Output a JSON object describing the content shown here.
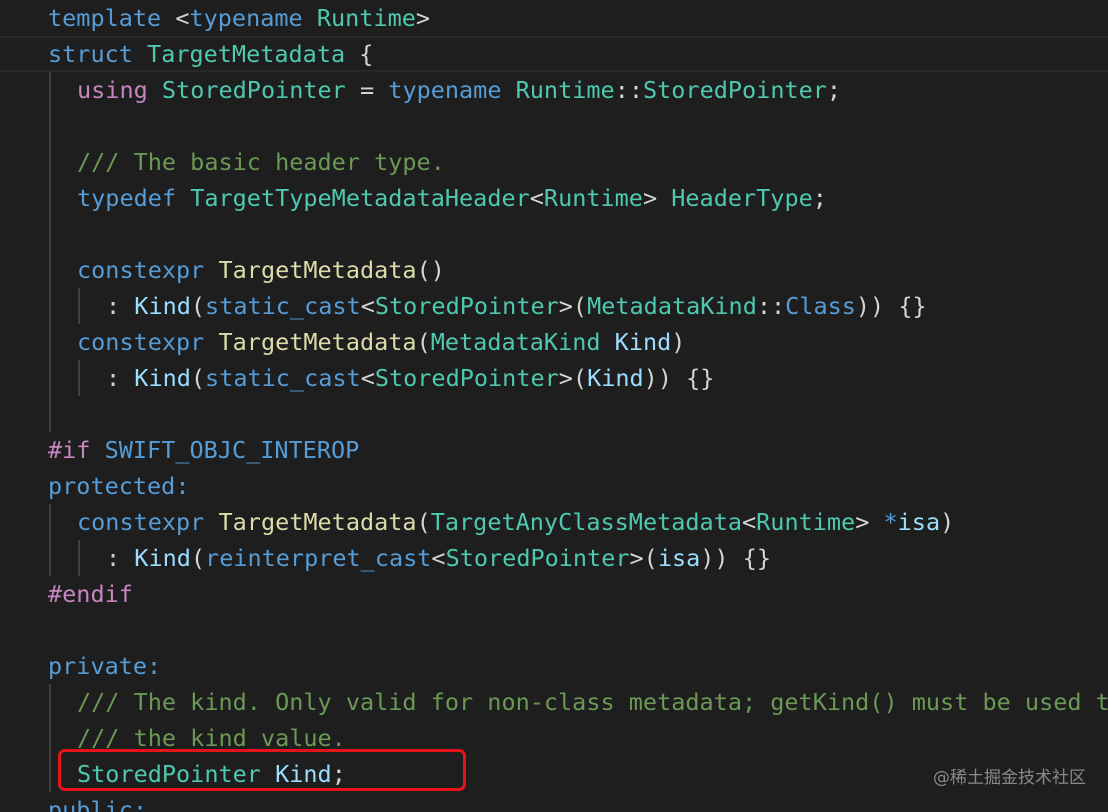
{
  "code_lines": [
    {
      "indent": 0,
      "tokens": [
        {
          "t": "template",
          "c": "kw"
        },
        {
          "t": " <",
          "c": "pn"
        },
        {
          "t": "typename",
          "c": "kw"
        },
        {
          "t": " ",
          "c": "pn"
        },
        {
          "t": "Runtime",
          "c": "ty"
        },
        {
          "t": ">",
          "c": "pn"
        }
      ]
    },
    {
      "indent": 0,
      "tokens": [
        {
          "t": "struct",
          "c": "kw"
        },
        {
          "t": " ",
          "c": "pn"
        },
        {
          "t": "TargetMetadata",
          "c": "ty"
        },
        {
          "t": " {",
          "c": "pn"
        }
      ]
    },
    {
      "indent": 1,
      "tokens": [
        {
          "t": "using",
          "c": "kw2"
        },
        {
          "t": " ",
          "c": "pn"
        },
        {
          "t": "StoredPointer",
          "c": "ty"
        },
        {
          "t": " = ",
          "c": "pn"
        },
        {
          "t": "typename",
          "c": "kw"
        },
        {
          "t": " ",
          "c": "pn"
        },
        {
          "t": "Runtime",
          "c": "ty"
        },
        {
          "t": "::",
          "c": "pn"
        },
        {
          "t": "StoredPointer",
          "c": "ty"
        },
        {
          "t": ";",
          "c": "pn"
        }
      ]
    },
    {
      "indent": 1,
      "tokens": []
    },
    {
      "indent": 1,
      "tokens": [
        {
          "t": "/// The basic header type.",
          "c": "cm"
        }
      ]
    },
    {
      "indent": 1,
      "tokens": [
        {
          "t": "typedef",
          "c": "kw"
        },
        {
          "t": " ",
          "c": "pn"
        },
        {
          "t": "TargetTypeMetadataHeader",
          "c": "ty"
        },
        {
          "t": "<",
          "c": "pn"
        },
        {
          "t": "Runtime",
          "c": "ty"
        },
        {
          "t": "> ",
          "c": "pn"
        },
        {
          "t": "HeaderType",
          "c": "ty"
        },
        {
          "t": ";",
          "c": "pn"
        }
      ]
    },
    {
      "indent": 1,
      "tokens": []
    },
    {
      "indent": 1,
      "tokens": [
        {
          "t": "constexpr",
          "c": "kw"
        },
        {
          "t": " ",
          "c": "pn"
        },
        {
          "t": "TargetMetadata",
          "c": "fn"
        },
        {
          "t": "()",
          "c": "pn"
        }
      ]
    },
    {
      "indent": 2,
      "tokens": [
        {
          "t": ": ",
          "c": "pn"
        },
        {
          "t": "Kind",
          "c": "vr"
        },
        {
          "t": "(",
          "c": "pn"
        },
        {
          "t": "static_cast",
          "c": "kw"
        },
        {
          "t": "<",
          "c": "pn"
        },
        {
          "t": "StoredPointer",
          "c": "ty"
        },
        {
          "t": ">(",
          "c": "pn"
        },
        {
          "t": "MetadataKind",
          "c": "ty"
        },
        {
          "t": "::",
          "c": "pn"
        },
        {
          "t": "Class",
          "c": "mc"
        },
        {
          "t": ")) {}",
          "c": "pn"
        }
      ]
    },
    {
      "indent": 1,
      "tokens": [
        {
          "t": "constexpr",
          "c": "kw"
        },
        {
          "t": " ",
          "c": "pn"
        },
        {
          "t": "TargetMetadata",
          "c": "fn"
        },
        {
          "t": "(",
          "c": "pn"
        },
        {
          "t": "MetadataKind",
          "c": "ty"
        },
        {
          "t": " ",
          "c": "pn"
        },
        {
          "t": "Kind",
          "c": "vr"
        },
        {
          "t": ")",
          "c": "pn"
        }
      ]
    },
    {
      "indent": 2,
      "tokens": [
        {
          "t": ": ",
          "c": "pn"
        },
        {
          "t": "Kind",
          "c": "vr"
        },
        {
          "t": "(",
          "c": "pn"
        },
        {
          "t": "static_cast",
          "c": "kw"
        },
        {
          "t": "<",
          "c": "pn"
        },
        {
          "t": "StoredPointer",
          "c": "ty"
        },
        {
          "t": ">(",
          "c": "pn"
        },
        {
          "t": "Kind",
          "c": "vr"
        },
        {
          "t": ")) {}",
          "c": "pn"
        }
      ]
    },
    {
      "indent": 1,
      "tokens": []
    },
    {
      "indent": 0,
      "tokens": [
        {
          "t": "#if",
          "c": "kw2"
        },
        {
          "t": " ",
          "c": "pn"
        },
        {
          "t": "SWIFT_OBJC_INTEROP",
          "c": "pp"
        }
      ]
    },
    {
      "indent": 0,
      "tokens": [
        {
          "t": "protected:",
          "c": "kw"
        }
      ]
    },
    {
      "indent": 1,
      "tokens": [
        {
          "t": "constexpr",
          "c": "kw"
        },
        {
          "t": " ",
          "c": "pn"
        },
        {
          "t": "TargetMetadata",
          "c": "fn"
        },
        {
          "t": "(",
          "c": "pn"
        },
        {
          "t": "TargetAnyClassMetadata",
          "c": "ty"
        },
        {
          "t": "<",
          "c": "pn"
        },
        {
          "t": "Runtime",
          "c": "ty"
        },
        {
          "t": "> ",
          "c": "pn"
        },
        {
          "t": "*",
          "c": "kw"
        },
        {
          "t": "isa",
          "c": "vr"
        },
        {
          "t": ")",
          "c": "pn"
        }
      ]
    },
    {
      "indent": 2,
      "tokens": [
        {
          "t": ": ",
          "c": "pn"
        },
        {
          "t": "Kind",
          "c": "vr"
        },
        {
          "t": "(",
          "c": "pn"
        },
        {
          "t": "reinterpret_cast",
          "c": "kw"
        },
        {
          "t": "<",
          "c": "pn"
        },
        {
          "t": "StoredPointer",
          "c": "ty"
        },
        {
          "t": ">(",
          "c": "pn"
        },
        {
          "t": "isa",
          "c": "vr"
        },
        {
          "t": ")) {}",
          "c": "pn"
        }
      ]
    },
    {
      "indent": 0,
      "tokens": [
        {
          "t": "#endif",
          "c": "kw2"
        }
      ]
    },
    {
      "indent": 0,
      "tokens": []
    },
    {
      "indent": 0,
      "tokens": [
        {
          "t": "private:",
          "c": "kw"
        }
      ]
    },
    {
      "indent": 1,
      "tokens": [
        {
          "t": "/// The kind. Only valid for non-class metadata; getKind() must be used to get",
          "c": "cm"
        }
      ]
    },
    {
      "indent": 1,
      "tokens": [
        {
          "t": "/// the kind value.",
          "c": "cm"
        }
      ]
    },
    {
      "indent": 1,
      "tokens": [
        {
          "t": "StoredPointer",
          "c": "ty"
        },
        {
          "t": " ",
          "c": "pn"
        },
        {
          "t": "Kind",
          "c": "vr"
        },
        {
          "t": ";",
          "c": "pn"
        }
      ]
    },
    {
      "indent": 0,
      "tokens": [
        {
          "t": "public:",
          "c": "kw"
        }
      ]
    }
  ],
  "watermark": "@稀土掘金技术社区"
}
